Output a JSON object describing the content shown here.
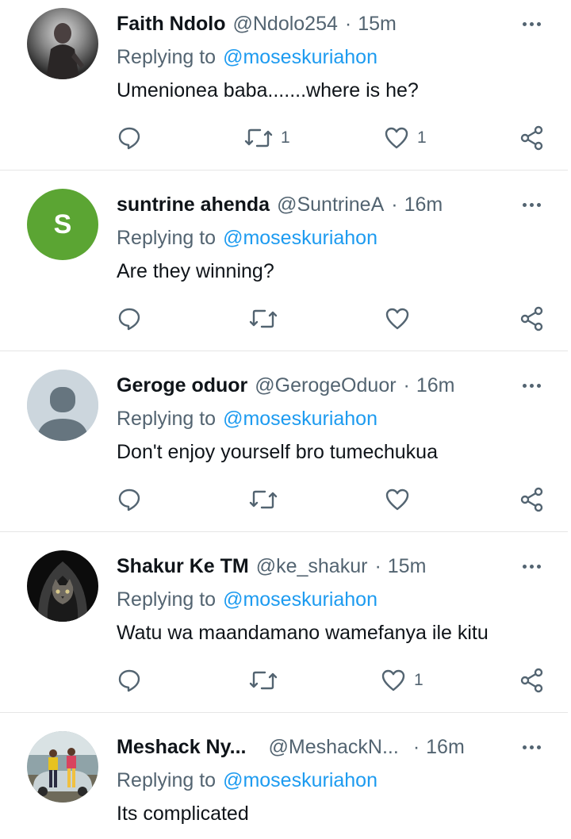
{
  "tweets": [
    {
      "name": "Faith Ndolo",
      "handle": "@Ndolo254",
      "separator": "·",
      "time": "15m",
      "replying_prefix": "Replying to",
      "replying_to": "@moseskuriahon",
      "text": "Umenionea baba.......where is he?",
      "retweets": "1",
      "likes": "1",
      "avatar": "photo"
    },
    {
      "name": "suntrine ahenda",
      "handle": "@SuntrineA",
      "separator": "·",
      "time": "16m",
      "replying_prefix": "Replying to",
      "replying_to": "@moseskuriahon",
      "text": "Are they winning?",
      "retweets": "",
      "likes": "",
      "avatar_letter": "S",
      "avatar_color": "#5ba533"
    },
    {
      "name": "Geroge oduor",
      "handle": "@GerogeOduor",
      "separator": "·",
      "time": "16m",
      "replying_prefix": "Replying to",
      "replying_to": "@moseskuriahon",
      "text": "Don't enjoy yourself bro tumechukua",
      "retweets": "",
      "likes": "",
      "avatar": "default-profile"
    },
    {
      "name": "Shakur Ke TM",
      "handle": "@ke_shakur",
      "separator": "·",
      "time": "15m",
      "replying_prefix": "Replying to",
      "replying_to": "@moseskuriahon",
      "text": "Watu wa maandamano wamefanya ile kitu",
      "retweets": "",
      "likes": "1",
      "avatar": "hooded-cat"
    },
    {
      "name": "Meshack Ny...",
      "handle": "@MeshackN...",
      "separator": "·",
      "time": "16m",
      "replying_prefix": "Replying to",
      "replying_to": "@moseskuriahon",
      "text": "Its complicated",
      "avatar": "photo"
    }
  ],
  "icons": [
    "reply-icon",
    "retweet-icon",
    "like-icon",
    "share-icon",
    "more-icon"
  ],
  "colors": {
    "link": "#1d9bf0",
    "secondary": "#536471",
    "text": "#0f1419"
  }
}
